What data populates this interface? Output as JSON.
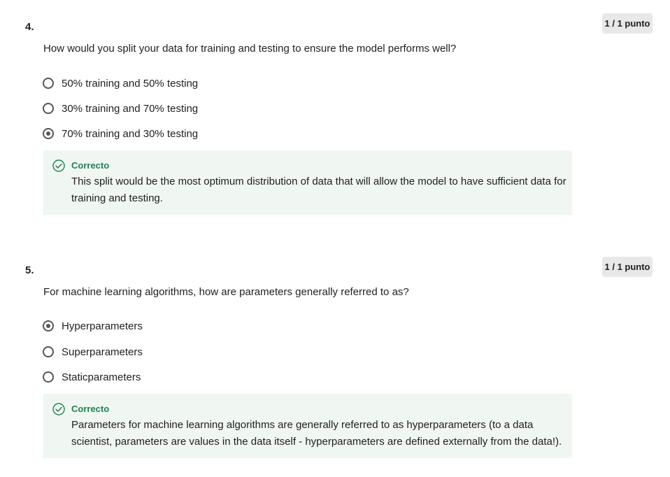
{
  "questions": [
    {
      "number": "4.",
      "score": "1 / 1 punto",
      "text": "How would you split your data for training and testing to ensure the model performs well?",
      "options": [
        {
          "label": "50% training and 50% testing",
          "selected": false
        },
        {
          "label": "30% training and 70% testing",
          "selected": false
        },
        {
          "label": "70% training and 30% testing",
          "selected": true
        }
      ],
      "feedback": {
        "status": "Correcto",
        "text": "This split would be the most optimum distribution of data that will allow the model to have sufficient data for training and testing."
      }
    },
    {
      "number": "5.",
      "score": "1 / 1 punto",
      "text": "For machine learning algorithms, how are parameters generally referred to as?",
      "options": [
        {
          "label": "Hyperparameters",
          "selected": true
        },
        {
          "label": "Superparameters",
          "selected": false
        },
        {
          "label": "Staticparameters",
          "selected": false
        }
      ],
      "feedback": {
        "status": "Correcto",
        "text": "Parameters for machine learning algorithms are generally referred to as hyperparameters (to a data scientist, parameters are values in the data itself - hyperparameters are defined externally from the data!)."
      }
    }
  ],
  "colors": {
    "correct_accent": "#1f8354",
    "feedback_background": "#f0f6f1",
    "badge_background": "#e8e8e8"
  },
  "icons": {
    "feedback_status": "check-circle-icon",
    "option_marker": "radio-button-icon"
  }
}
